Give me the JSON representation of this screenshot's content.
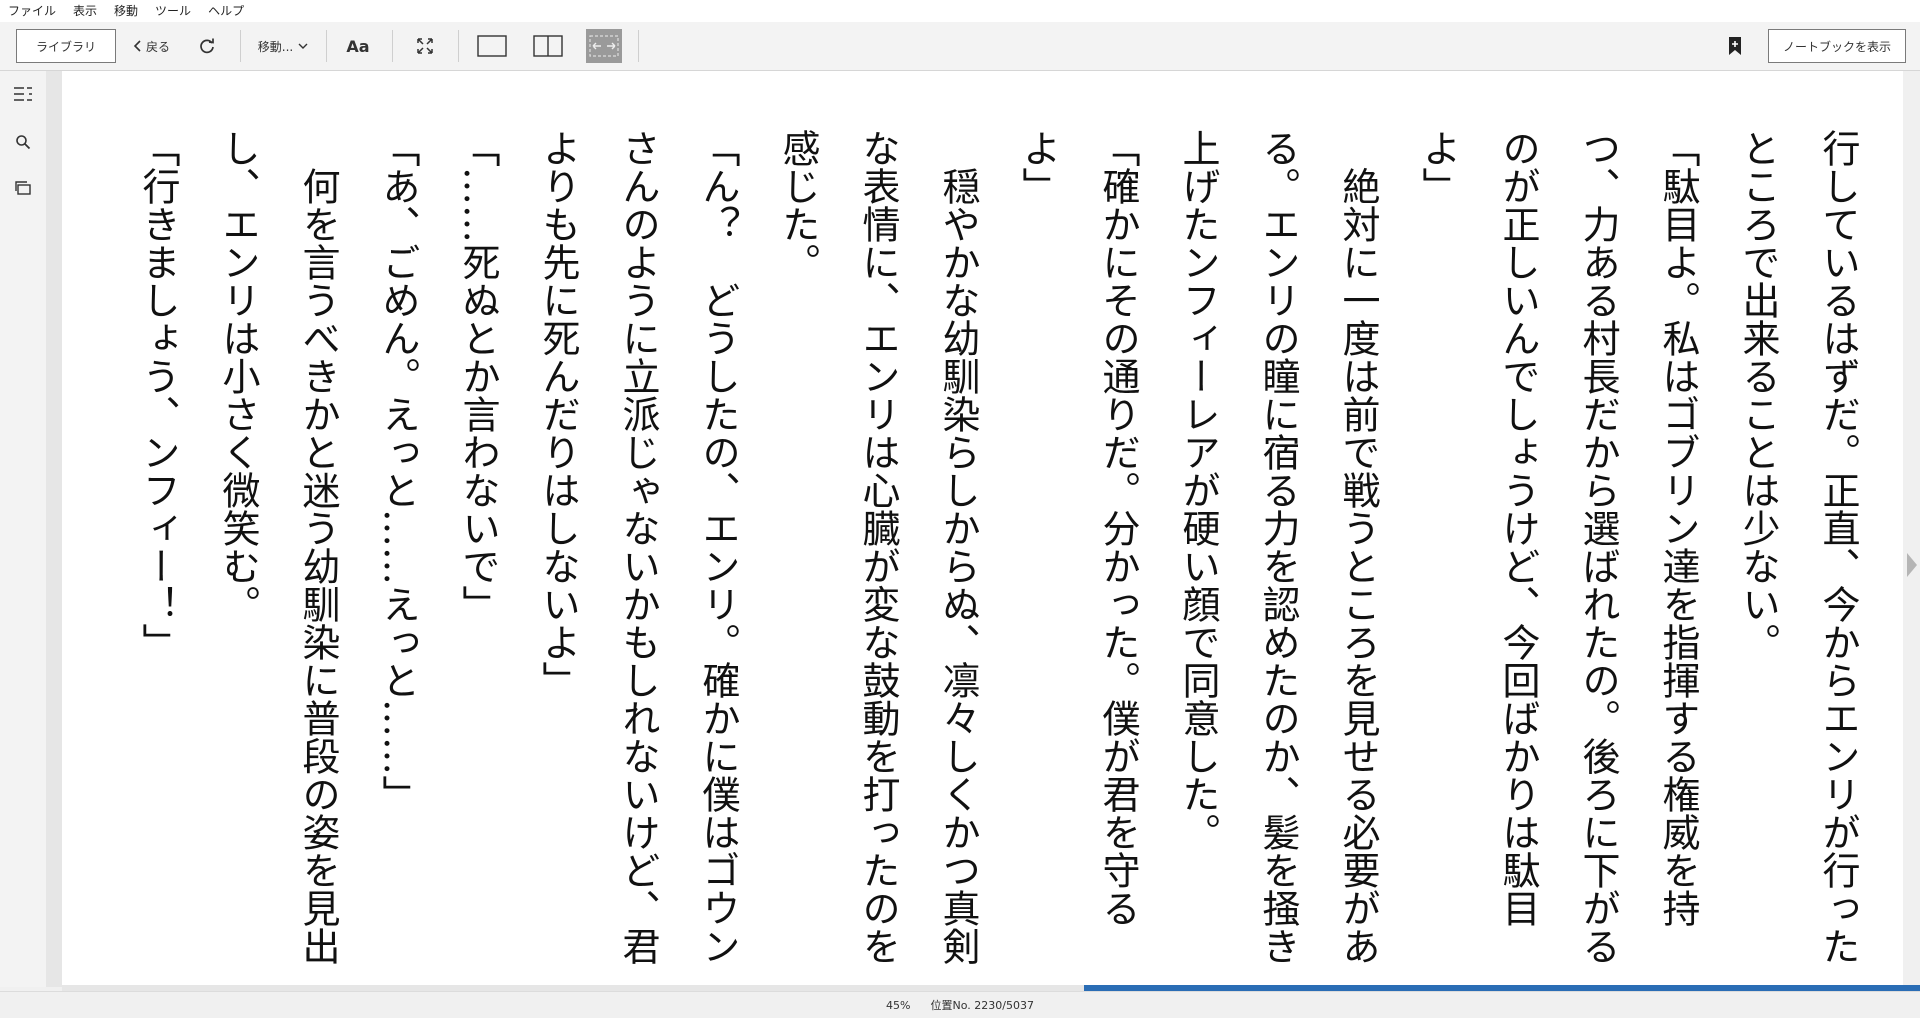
{
  "menu": [
    "ファイル",
    "表示",
    "移動",
    "ツール",
    "ヘルプ"
  ],
  "toolbar": {
    "library_label": "ライブラリ",
    "back_label": "戻る",
    "goto_label": "移動...",
    "font_label": "Aa",
    "notebook_label": "ノートブックを表示"
  },
  "icons": {
    "back": "chevron-left-icon",
    "refresh": "refresh-icon",
    "goto_dropdown": "chevron-down-icon",
    "fullscreen": "fullscreen-icon",
    "single_column": "single-column-layout-icon",
    "two_column": "two-column-layout-icon",
    "fit_width": "fit-width-layout-icon",
    "bookmark": "bookmark-add-icon",
    "toc": "table-of-contents-icon",
    "search": "search-icon",
    "flashcards": "flashcards-icon",
    "next_page": "next-page-arrow-icon"
  },
  "colors": {
    "progress": "#2a6db5",
    "page_background": "#ffffff",
    "chrome": "#f3f3f3"
  },
  "content": {
    "paragraphs": [
      "行しているはずだ。正直、今からエンリが行ったところで出来ることは少ない。",
      "「駄目よ。私はゴブリン達を指揮する権威を持つ、力ある村長だから選ばれたの。後ろに下がるのが正しいんでしょうけど、今回ばかりは駄目よ」",
      "　絶対に一度は前で戦うところを見せる必要がある。エンリの瞳に宿る力を認めたのか、髪を掻き上げたンフィーレアが硬い顔で同意した。",
      "「確かにその通りだ。分かった。僕が君を守るよ」",
      "　穏やかな幼馴染らしからぬ、凛々しくかつ真剣な表情に、エンリは心臓が変な鼓動を打ったのを感じた。",
      "「ん？　どうしたの、エンリ。確かに僕はゴウンさんのように立派じゃないかもしれないけど、君よりも先に死んだりはしないよ」",
      "「……死ぬとか言わないで」",
      "「あ、ごめん。えっと……えっと……」",
      "　何を言うべきかと迷う幼馴染に普段の姿を見出し、エンリは小さく微笑む。",
      "「行きましょう、ンフィー！」"
    ]
  },
  "status": {
    "percent_text": "45%",
    "progress": 0.45,
    "location_text": "位置No. 2230/5037"
  }
}
